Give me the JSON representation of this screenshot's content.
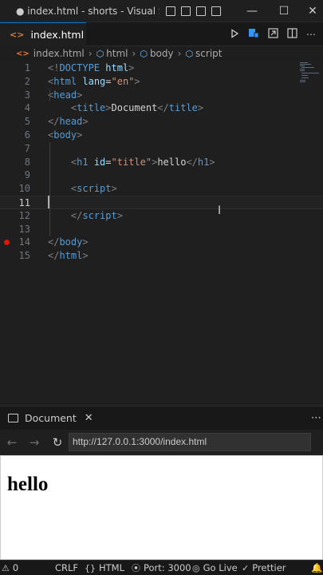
{
  "window": {
    "title": "● index.html - shorts - Visual Studio C...",
    "controls": {
      "minimize": "—",
      "maximize": "☐",
      "close": "✕"
    }
  },
  "tab": {
    "icon": "<>",
    "label": "index.html",
    "modified": true
  },
  "breadcrumb": [
    "index.html",
    "html",
    "body",
    "script"
  ],
  "editor": {
    "lines": [
      {
        "num": "1",
        "tokens": [
          [
            "p",
            "<!"
          ],
          [
            "t",
            "DOCTYPE"
          ],
          [
            "x",
            " "
          ],
          [
            "a",
            "html"
          ],
          [
            "p",
            ">"
          ]
        ]
      },
      {
        "num": "2",
        "tokens": [
          [
            "p",
            "<"
          ],
          [
            "t",
            "html"
          ],
          [
            "x",
            " "
          ],
          [
            "a",
            "lang"
          ],
          [
            "x",
            "="
          ],
          [
            "s",
            "\"en\""
          ],
          [
            "p",
            ">"
          ]
        ]
      },
      {
        "num": "3",
        "tokens": [
          [
            "p",
            "<"
          ],
          [
            "t",
            "head"
          ],
          [
            "p",
            ">"
          ]
        ]
      },
      {
        "num": "4",
        "tokens": [
          [
            "x",
            "    "
          ],
          [
            "p",
            "<"
          ],
          [
            "t",
            "title"
          ],
          [
            "p",
            ">"
          ],
          [
            "x",
            "Document"
          ],
          [
            "p",
            "</"
          ],
          [
            "t",
            "title"
          ],
          [
            "p",
            ">"
          ]
        ]
      },
      {
        "num": "5",
        "tokens": [
          [
            "p",
            "</"
          ],
          [
            "t",
            "head"
          ],
          [
            "p",
            ">"
          ]
        ]
      },
      {
        "num": "6",
        "tokens": [
          [
            "p",
            "<"
          ],
          [
            "t",
            "body"
          ],
          [
            "p",
            ">"
          ]
        ]
      },
      {
        "num": "7",
        "tokens": []
      },
      {
        "num": "8",
        "tokens": [
          [
            "x",
            "    "
          ],
          [
            "p",
            "<"
          ],
          [
            "t",
            "h1"
          ],
          [
            "x",
            " "
          ],
          [
            "a",
            "id"
          ],
          [
            "x",
            "="
          ],
          [
            "s",
            "\"title\""
          ],
          [
            "p",
            ">"
          ],
          [
            "x",
            "hello"
          ],
          [
            "p",
            "</"
          ],
          [
            "t",
            "h1"
          ],
          [
            "p",
            ">"
          ]
        ]
      },
      {
        "num": "9",
        "tokens": []
      },
      {
        "num": "10",
        "tokens": [
          [
            "x",
            "    "
          ],
          [
            "p",
            "<"
          ],
          [
            "t",
            "script"
          ],
          [
            "p",
            ">"
          ]
        ]
      },
      {
        "num": "11",
        "tokens": []
      },
      {
        "num": "12",
        "tokens": [
          [
            "x",
            "    "
          ],
          [
            "p",
            "</"
          ],
          [
            "t",
            "script"
          ],
          [
            "p",
            ">"
          ]
        ]
      },
      {
        "num": "13",
        "tokens": []
      },
      {
        "num": "14",
        "tokens": [
          [
            "p",
            "</"
          ],
          [
            "t",
            "body"
          ],
          [
            "p",
            ">"
          ]
        ]
      },
      {
        "num": "15",
        "tokens": [
          [
            "p",
            "</"
          ],
          [
            "t",
            "html"
          ],
          [
            "p",
            ">"
          ]
        ]
      }
    ],
    "active_line": "11",
    "breakpoint_line": "14"
  },
  "panel": {
    "tab_label": "Document",
    "close": "✕",
    "more": "⋯",
    "back": "←",
    "forward": "→",
    "reload": "↻",
    "url": "http://127.0.0.1:3000/index.html",
    "page_heading": "hello"
  },
  "status": {
    "problems": "0",
    "eol": "CRLF",
    "language": "HTML",
    "port": "Port: 3000",
    "go_live": "Go Live",
    "prettier": "Prettier"
  },
  "colors": {
    "tag": "#569cd6",
    "attribute": "#9cdcfe",
    "string": "#ce9178",
    "punctuation": "#808080",
    "accent": "#0078d4",
    "breakpoint": "#e51400"
  }
}
